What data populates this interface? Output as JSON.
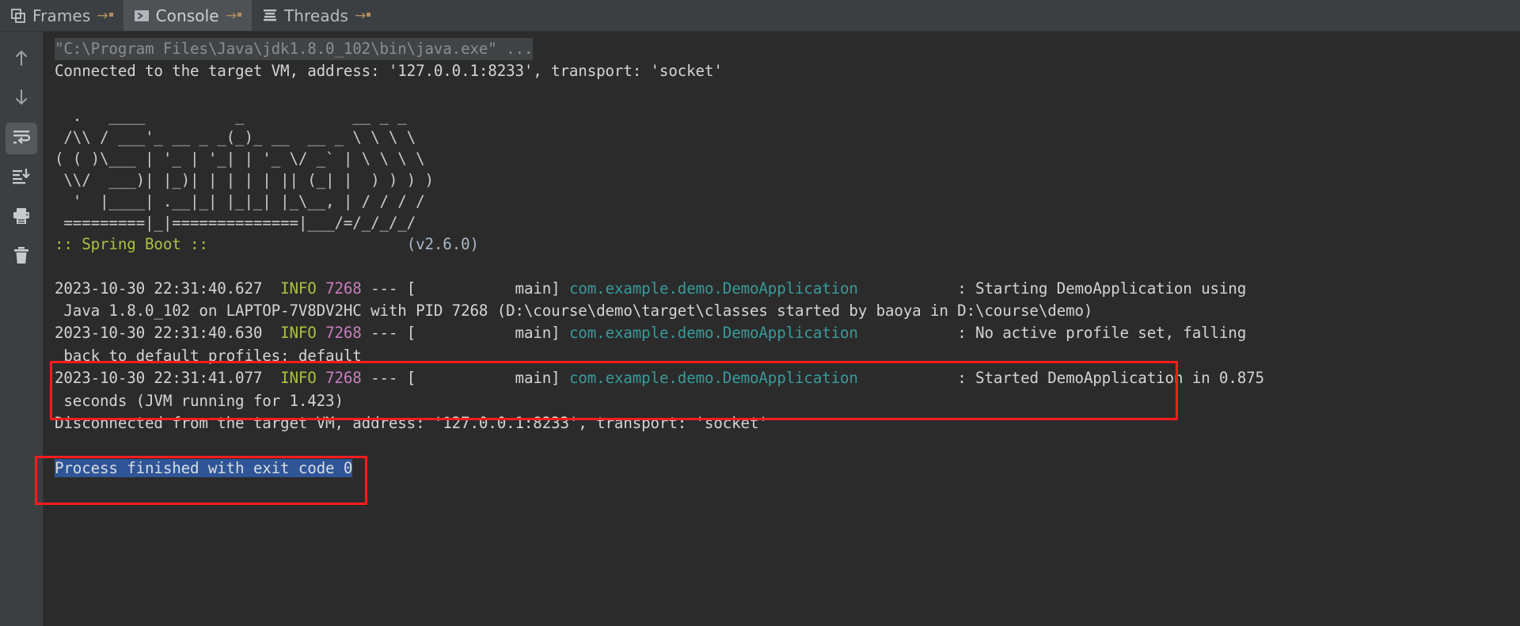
{
  "window": {
    "background": "#2b2b2b",
    "chrome_background": "#3c3f41"
  },
  "tabs": [
    {
      "id": "frames",
      "label": "Frames",
      "icon": "frames-icon",
      "arrow": "→",
      "active": false
    },
    {
      "id": "console",
      "label": "Console",
      "icon": "console-icon",
      "arrow": "→",
      "active": true
    },
    {
      "id": "threads",
      "label": "Threads",
      "icon": "threads-icon",
      "arrow": "→",
      "active": false
    }
  ],
  "toolbar": {
    "buttons": [
      {
        "id": "up",
        "icon": "arrow-up-icon",
        "title": "Up the Stack Trace",
        "selected": false
      },
      {
        "id": "down",
        "icon": "arrow-down-icon",
        "title": "Down the Stack Trace",
        "selected": false
      },
      {
        "id": "soft-wrap",
        "icon": "soft-wrap-icon",
        "title": "Soft-Wrap",
        "selected": true
      },
      {
        "id": "scroll-end",
        "icon": "scroll-to-end-icon",
        "title": "Scroll to the End",
        "selected": false
      },
      {
        "id": "print",
        "icon": "print-icon",
        "title": "Print",
        "selected": false
      },
      {
        "id": "clear-all",
        "icon": "trash-icon",
        "title": "Clear All",
        "selected": false
      }
    ]
  },
  "console": {
    "command_line": "\"C:\\Program Files\\Java\\jdk1.8.0_102\\bin\\java.exe\" ...",
    "connected_line": "Connected to the target VM, address: '127.0.0.1:8233', transport: 'socket'",
    "banner": {
      "lines": [
        "  .   ____          _            __ _ _",
        " /\\\\ / ___'_ __ _ _(_)_ __  __ _ \\ \\ \\ \\",
        "( ( )\\___ | '_ | '_| | '_ \\/ _` | \\ \\ \\ \\",
        " \\\\/  ___)| |_)| | | | | || (_| |  ) ) ) )",
        "  '  |____| .__|_| |_|_| |_\\__, | / / / /",
        " =========|_|==============|___/=/_/_/_/"
      ],
      "footer_label": ":: Spring Boot ::",
      "footer_version": "(v2.6.0)",
      "footer_color": "#a9c23f"
    },
    "log_entries": [
      {
        "timestamp": "2023-10-30 22:31:40.627",
        "level": "INFO",
        "pid": "7268",
        "separator": "---",
        "thread": "main",
        "logger": "com.example.demo.DemoApplication",
        "message": ": Starting DemoApplication using",
        "continuation": " Java 1.8.0_102 on LAPTOP-7V8DV2HC with PID 7268 (D:\\course\\demo\\target\\classes started by baoya in D:\\course\\demo)",
        "highlight": false
      },
      {
        "timestamp": "2023-10-30 22:31:40.630",
        "level": "INFO",
        "pid": "7268",
        "separator": "---",
        "thread": "main",
        "logger": "com.example.demo.DemoApplication",
        "message": ": No active profile set, falling",
        "continuation": " back to default profiles: default",
        "highlight": false
      },
      {
        "timestamp": "2023-10-30 22:31:41.077",
        "level": "INFO",
        "pid": "7268",
        "separator": "---",
        "thread": "main",
        "logger": "com.example.demo.DemoApplication",
        "message": ": Started DemoApplication in 0.875",
        "continuation": " seconds (JVM running for 1.423)",
        "highlight": true
      }
    ],
    "disconnected_line": "Disconnected from the target VM, address: '127.0.0.1:8233', transport: 'socket'",
    "exit_line": "Process finished with exit code 0",
    "colors": {
      "timestamp": "#d4d4d4",
      "level": "#a9c23f",
      "pid": "#c77dbb",
      "thread": "#d4d4d4",
      "logger": "#3a9a9a",
      "message": "#d4d4d4",
      "selection_background": "#2f5597",
      "annotation": "#ff1c1c"
    }
  },
  "annotations": [
    {
      "id": "started-box",
      "label": "started-application-highlight",
      "color": "#ff1c1c"
    },
    {
      "id": "exit-box",
      "label": "process-exit-highlight",
      "color": "#ff1c1c"
    }
  ]
}
